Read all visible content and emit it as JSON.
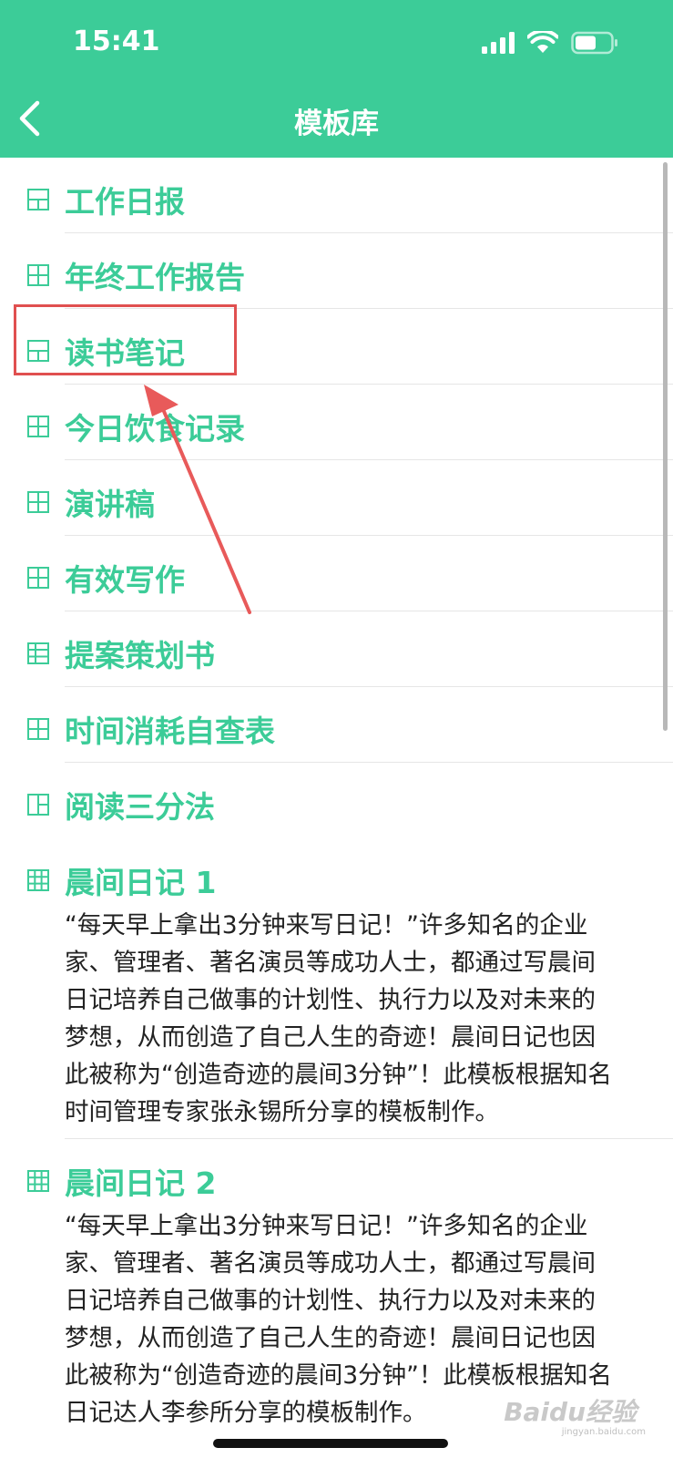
{
  "status": {
    "time": "15:41"
  },
  "header": {
    "title": "模板库"
  },
  "colors": {
    "accent": "#3ccc98",
    "highlight": "#e05050"
  },
  "templates": [
    {
      "label": "工作日报"
    },
    {
      "label": "年终工作报告"
    },
    {
      "label": "读书笔记"
    },
    {
      "label": "今日饮食记录"
    },
    {
      "label": "演讲稿"
    },
    {
      "label": "有效写作"
    },
    {
      "label": "提案策划书"
    },
    {
      "label": "时间消耗自查表"
    },
    {
      "label": "阅读三分法"
    }
  ],
  "detailed_templates": [
    {
      "label": "晨间日记 1",
      "lines": [
        "“每天早上拿出3分钟来写日记！”许多知名的企业",
        "家、管理者、著名演员等成功人士，都通过写晨间",
        "日记培养自己做事的计划性、执行力以及对未来的",
        "梦想，从而创造了自己人生的奇迹！晨间日记也因",
        "此被称为“创造奇迹的晨间3分钟”！此模板根据知名",
        "时间管理专家张永锡所分享的模板制作。"
      ]
    },
    {
      "label": "晨间日记 2",
      "lines": [
        "“每天早上拿出3分钟来写日记！”许多知名的企业",
        "家、管理者、著名演员等成功人士，都通过写晨间",
        "日记培养自己做事的计划性、执行力以及对未来的",
        "梦想，从而创造了自己人生的奇迹！晨间日记也因",
        "此被称为“创造奇迹的晨间3分钟”！此模板根据知名",
        "日记达人李参所分享的模板制作。"
      ]
    }
  ],
  "watermark": {
    "text": "Baidu经验",
    "sub": "jingyan.baidu.com"
  }
}
